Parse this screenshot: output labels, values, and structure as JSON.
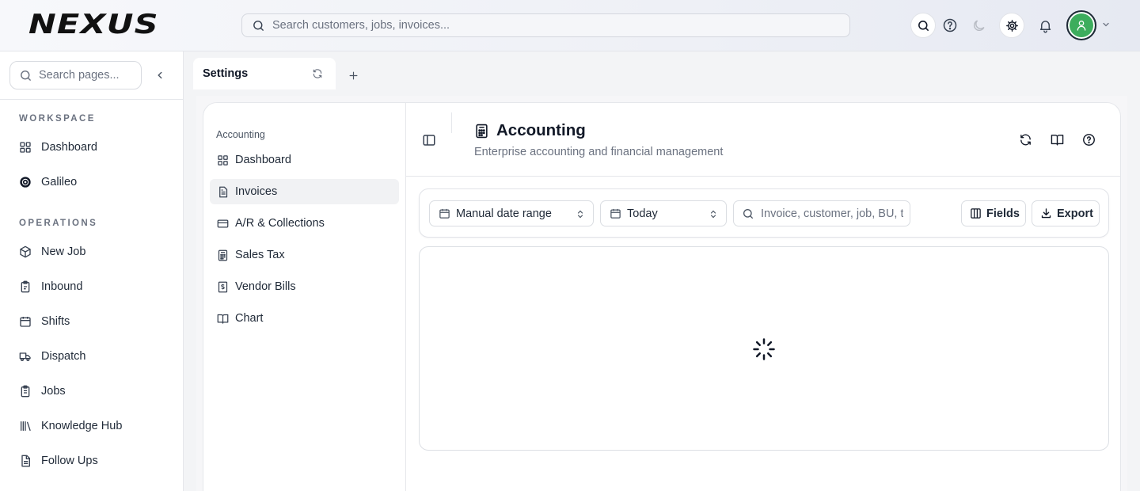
{
  "topbar": {
    "logo_text": "NEXUS",
    "search_placeholder": "Search customers, jobs, invoices...",
    "icons": [
      "search-icon",
      "help-icon",
      "moon-icon",
      "settings-icon",
      "bell-icon"
    ],
    "avatar_color": "#3dad5d"
  },
  "sidebar": {
    "search_placeholder": "Search pages...",
    "workspace_title": "WORKSPACE",
    "workspace_items": [
      {
        "label": "Dashboard",
        "icon": "dashboard-icon"
      },
      {
        "label": "Galileo",
        "icon": "galileo-icon"
      }
    ],
    "operations_title": "OPERATIONS",
    "operations_items": [
      {
        "label": "New Job",
        "icon": "new-job-icon"
      },
      {
        "label": "Inbound",
        "icon": "inbound-icon"
      },
      {
        "label": "Shifts",
        "icon": "calendar-icon"
      },
      {
        "label": "Dispatch",
        "icon": "truck-icon"
      },
      {
        "label": "Jobs",
        "icon": "clipboard-icon"
      },
      {
        "label": "Knowledge Hub",
        "icon": "library-icon"
      },
      {
        "label": "Follow Ups",
        "icon": "document-icon"
      }
    ]
  },
  "tabs": {
    "active_label": "Settings"
  },
  "subnav": {
    "title": "Accounting",
    "items": [
      {
        "label": "Dashboard",
        "icon": "dashboard-icon",
        "active": false
      },
      {
        "label": "Invoices",
        "icon": "invoice-icon",
        "active": true
      },
      {
        "label": "A/R & Collections",
        "icon": "credit-card-icon",
        "active": false
      },
      {
        "label": "Sales Tax",
        "icon": "calculator-icon",
        "active": false
      },
      {
        "label": "Vendor Bills",
        "icon": "receipt-icon",
        "active": false
      },
      {
        "label": "Chart",
        "icon": "book-icon",
        "active": false
      }
    ]
  },
  "main": {
    "title": "Accounting",
    "subtitle": "Enterprise accounting and financial management",
    "toolbar": {
      "date_range_label": "Manual date range",
      "period_label": "Today",
      "search_placeholder": "Invoice, customer, job, BU, t",
      "fields_label": "Fields",
      "export_label": "Export"
    },
    "results_state": "loading"
  }
}
